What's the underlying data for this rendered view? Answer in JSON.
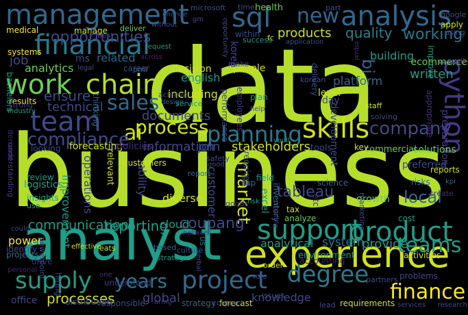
{
  "palette": {
    "lime": "#b5de2b",
    "yellow": "#fde725",
    "yellowgreen": "#d0e11c",
    "green": "#6ece58",
    "teal": "#1f9e89",
    "teal2": "#25838e",
    "blue": "#2a788e",
    "steel": "#31688e",
    "indigo": "#3e4a89",
    "purple": "#472d7b",
    "darkpurple": "#482173",
    "violet": "#443983"
  },
  "words": [
    {
      "text": "data",
      "color": "lime"
    },
    {
      "text": "business",
      "color": "lime"
    },
    {
      "text": "analyst",
      "color": "teal"
    },
    {
      "text": "experience",
      "color": "yellowgreen"
    },
    {
      "text": "management",
      "color": "steel"
    },
    {
      "text": "analysis",
      "color": "steel"
    },
    {
      "text": "sql",
      "color": "steel"
    },
    {
      "text": "financial",
      "color": "blue"
    },
    {
      "text": "work",
      "color": "green"
    },
    {
      "text": "chain",
      "color": "lime"
    },
    {
      "text": "team",
      "color": "indigo"
    },
    {
      "text": "sales",
      "color": "steel"
    },
    {
      "text": "ai",
      "color": "yellowgreen"
    },
    {
      "text": "process",
      "color": "yellowgreen"
    },
    {
      "text": "skills",
      "color": "yellowgreen"
    },
    {
      "text": "planning",
      "color": "blue"
    },
    {
      "text": "company",
      "color": "indigo"
    },
    {
      "text": "python",
      "color": "violet"
    },
    {
      "text": "support",
      "color": "teal"
    },
    {
      "text": "product",
      "color": "teal"
    },
    {
      "text": "supply",
      "color": "teal"
    },
    {
      "text": "project",
      "color": "steel"
    },
    {
      "text": "years",
      "color": "blue"
    },
    {
      "text": "degree",
      "color": "blue"
    },
    {
      "text": "finance",
      "color": "yellow"
    },
    {
      "text": "teams",
      "color": "teal"
    },
    {
      "text": "compliance",
      "color": "indigo"
    },
    {
      "text": "new",
      "color": "steel"
    },
    {
      "text": "quality",
      "color": "teal2"
    },
    {
      "text": "working",
      "color": "blue"
    },
    {
      "text": "bi",
      "color": "steel"
    },
    {
      "text": "opportunities",
      "color": "indigo"
    },
    {
      "text": "ensure",
      "color": "indigo"
    },
    {
      "text": "technical",
      "color": "indigo"
    },
    {
      "text": "documents",
      "color": "indigo"
    },
    {
      "text": "information",
      "color": "indigo"
    },
    {
      "text": "stakeholders",
      "color": "yellowgreen"
    },
    {
      "text": "market",
      "color": "yellowgreen"
    },
    {
      "text": "tableau",
      "color": "indigo"
    },
    {
      "text": "local",
      "color": "steel"
    },
    {
      "text": "communication",
      "color": "teal"
    },
    {
      "text": "reporting",
      "color": "teal"
    },
    {
      "text": "coupang",
      "color": "indigo"
    },
    {
      "text": "analytical",
      "color": "teal"
    },
    {
      "text": "system",
      "color": "blue"
    },
    {
      "text": "provide",
      "color": "teal"
    },
    {
      "text": "processes",
      "color": "yellowgreen"
    },
    {
      "text": "global",
      "color": "indigo"
    },
    {
      "text": "knowledge",
      "color": "indigo"
    },
    {
      "text": "products",
      "color": "yellowgreen"
    },
    {
      "text": "building",
      "color": "teal"
    },
    {
      "text": "ecommerce",
      "color": "green"
    },
    {
      "text": "written",
      "color": "teal"
    },
    {
      "text": "preparation",
      "color": "violet"
    },
    {
      "text": "platform",
      "color": "steel"
    },
    {
      "text": "development",
      "color": "indigo"
    },
    {
      "text": "day",
      "color": "indigo"
    },
    {
      "text": "analytics",
      "color": "green"
    },
    {
      "text": "job",
      "color": "indigo"
    },
    {
      "text": "related",
      "color": "steel"
    },
    {
      "text": "english",
      "color": "teal"
    },
    {
      "text": "decision",
      "color": "yellowgreen"
    },
    {
      "text": "people",
      "color": "yellowgreen"
    },
    {
      "text": "including",
      "color": "yellowgreen"
    },
    {
      "text": "operations",
      "color": "indigo"
    },
    {
      "text": "ability",
      "color": "indigo"
    },
    {
      "text": "customer",
      "color": "indigo"
    },
    {
      "text": "join",
      "color": "indigo"
    },
    {
      "text": "forecasting",
      "color": "yellowgreen"
    },
    {
      "text": "policies",
      "color": "purple"
    },
    {
      "text": "logistics",
      "color": "teal"
    },
    {
      "text": "improvement",
      "color": "teal"
    },
    {
      "text": "review",
      "color": "teal"
    },
    {
      "text": "power",
      "color": "yellow"
    },
    {
      "text": "identify",
      "color": "indigo"
    },
    {
      "text": "projects",
      "color": "steel"
    },
    {
      "text": "drive",
      "color": "purple"
    },
    {
      "text": "office",
      "color": "indigo"
    },
    {
      "text": "distribution",
      "color": "indigo"
    },
    {
      "text": "strategy",
      "color": "steel"
    },
    {
      "text": "forecast",
      "color": "yellowgreen"
    },
    {
      "text": "requirements",
      "color": "yellowgreen"
    },
    {
      "text": "research",
      "color": "indigo"
    },
    {
      "text": "services",
      "color": "indigo"
    },
    {
      "text": "cloud",
      "color": "teal"
    },
    {
      "text": "diverse",
      "color": "yellowgreen"
    },
    {
      "text": "excel",
      "color": "teal"
    },
    {
      "text": "growth",
      "color": "green"
    },
    {
      "text": "solutions",
      "color": "green"
    },
    {
      "text": "commercial",
      "color": "green"
    },
    {
      "text": "tools",
      "color": "indigo"
    },
    {
      "text": "key",
      "color": "yellowgreen"
    },
    {
      "text": "reports",
      "color": "yellowgreen"
    },
    {
      "text": "preferred",
      "color": "indigo"
    },
    {
      "text": "risks",
      "color": "steel"
    },
    {
      "text": "kpi",
      "color": "steel"
    },
    {
      "text": "tax",
      "color": "yellowgreen"
    },
    {
      "text": "analyze",
      "color": "green"
    },
    {
      "text": "cost",
      "color": "teal"
    },
    {
      "text": "environment",
      "color": "teal"
    },
    {
      "text": "activities",
      "color": "yellowgreen"
    },
    {
      "text": "accounting",
      "color": "darkpurple"
    },
    {
      "text": "medical",
      "color": "yellow"
    },
    {
      "text": "systems",
      "color": "yellow"
    },
    {
      "text": "results",
      "color": "yellow"
    },
    {
      "text": "manage",
      "color": "yellowgreen"
    },
    {
      "text": "best",
      "color": "violet"
    },
    {
      "text": "deliver",
      "color": "green"
    },
    {
      "text": "field",
      "color": "teal"
    },
    {
      "text": "sap",
      "color": "steel"
    },
    {
      "text": "inventory",
      "color": "blue"
    },
    {
      "text": "science",
      "color": "steel"
    },
    {
      "text": "korea",
      "color": "indigo"
    },
    {
      "text": "level",
      "color": "yellowgreen"
    },
    {
      "text": "plan",
      "color": "teal"
    },
    {
      "text": "microsoft",
      "color": "indigo"
    },
    {
      "text": "time",
      "color": "indigo"
    },
    {
      "text": "health",
      "color": "green"
    },
    {
      "text": "google",
      "color": "indigo"
    },
    {
      "text": "apply",
      "color": "yellowgreen"
    },
    {
      "text": "using",
      "color": "indigo"
    },
    {
      "text": "well",
      "color": "violet"
    },
    {
      "text": "part",
      "color": "indigo"
    },
    {
      "text": "gm",
      "color": "indigo"
    },
    {
      "text": "opportunity",
      "color": "indigo"
    },
    {
      "text": "within",
      "color": "indigo"
    },
    {
      "text": "success",
      "color": "teal"
    },
    {
      "text": "fc",
      "color": "yellowgreen"
    },
    {
      "text": "application",
      "color": "indigo"
    },
    {
      "text": "equal",
      "color": "purple"
    },
    {
      "text": "ms",
      "color": "indigo"
    },
    {
      "text": "career",
      "color": "indigo"
    },
    {
      "text": "pmi",
      "color": "steel"
    },
    {
      "text": "legal",
      "color": "indigo"
    },
    {
      "text": "korean",
      "color": "indigo"
    },
    {
      "text": "bachelors",
      "color": "teal"
    },
    {
      "text": "strong",
      "color": "violet"
    },
    {
      "text": "industry",
      "color": "teal"
    },
    {
      "text": "demand",
      "color": "darkpurple"
    },
    {
      "text": "thinking",
      "color": "steel"
    },
    {
      "text": "achieve",
      "color": "indigo"
    },
    {
      "text": "design",
      "color": "steel"
    },
    {
      "text": "service",
      "color": "teal"
    },
    {
      "text": "employees",
      "color": "violet"
    },
    {
      "text": "help",
      "color": "indigo"
    },
    {
      "text": "make",
      "color": "indigo"
    },
    {
      "text": "performance",
      "color": "indigo"
    },
    {
      "text": "staff",
      "color": "yellowgreen"
    },
    {
      "text": "solving",
      "color": "indigo"
    },
    {
      "text": "delivery",
      "color": "indigo"
    },
    {
      "text": "improve",
      "color": "teal"
    },
    {
      "text": "appropriate",
      "color": "purple"
    },
    {
      "text": "youll",
      "color": "teal"
    },
    {
      "text": "safety",
      "color": "indigo"
    },
    {
      "text": "good",
      "color": "indigo"
    },
    {
      "text": "report",
      "color": "steel"
    },
    {
      "text": "relevant",
      "color": "yellowgreen"
    },
    {
      "text": "customers",
      "color": "yellowgreen"
    },
    {
      "text": "looking",
      "color": "indigo"
    },
    {
      "text": "understanding",
      "color": "violet"
    },
    {
      "text": "insights",
      "color": "teal"
    },
    {
      "text": "use",
      "color": "teal"
    },
    {
      "text": "could",
      "color": "indigo"
    },
    {
      "text": "personal",
      "color": "darkpurple"
    },
    {
      "text": "powerpoint",
      "color": "indigo"
    },
    {
      "text": "hiring",
      "color": "indigo"
    },
    {
      "text": "responsible",
      "color": "indigo"
    },
    {
      "text": "effective",
      "color": "yellowgreen"
    },
    {
      "text": "eats",
      "color": "yellowgreen"
    },
    {
      "text": "one",
      "color": "purple"
    },
    {
      "text": "understand",
      "color": "violet"
    },
    {
      "text": "based",
      "color": "steel"
    },
    {
      "text": "strategic",
      "color": "teal"
    },
    {
      "text": "culture",
      "color": "indigo"
    },
    {
      "text": "network",
      "color": "violet"
    },
    {
      "text": "verbal",
      "color": "indigo"
    },
    {
      "text": "contract",
      "color": "indigo"
    },
    {
      "text": "issues",
      "color": "indigo"
    },
    {
      "text": "order",
      "color": "yellowgreen"
    },
    {
      "text": "us",
      "color": "steel"
    },
    {
      "text": "required",
      "color": "indigo"
    },
    {
      "text": "risk",
      "color": "teal"
    },
    {
      "text": "pm",
      "color": "indigo"
    },
    {
      "text": "possible",
      "color": "purple"
    },
    {
      "text": "role",
      "color": "indigo"
    },
    {
      "text": "etc",
      "color": "purple"
    },
    {
      "text": "partners",
      "color": "indigo"
    },
    {
      "text": "problems",
      "color": "indigo"
    },
    {
      "text": "lead",
      "color": "indigo"
    },
    {
      "text": "marketing",
      "color": "indigo"
    },
    {
      "text": "create",
      "color": "purple"
    },
    {
      "text": "goods",
      "color": "violet"
    },
    {
      "text": "bring",
      "color": "purple"
    },
    {
      "text": "change",
      "color": "indigo"
    },
    {
      "text": "without",
      "color": "indigo"
    },
    {
      "text": "across",
      "color": "darkpurple"
    },
    {
      "text": "request",
      "color": "teal"
    }
  ]
}
